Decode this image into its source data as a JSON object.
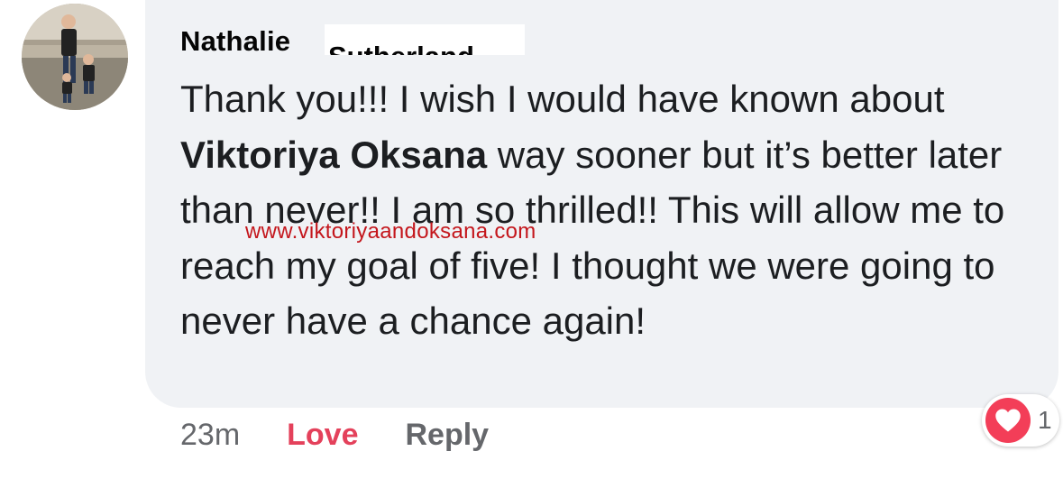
{
  "comment": {
    "author": "Nathalie",
    "author_redacted_fragment": "Sutherland",
    "text_before": "Thank you!!! I wish I would have known about ",
    "mention": "Viktoriya Oksana",
    "text_after": " way sooner but it’s better later than never!! I am so thrilled!! This will allow me to reach my goal of five! I thought we were going to never have a chance again!"
  },
  "watermark": "www.viktoriyaandoksana.com",
  "actions": {
    "time": "23m",
    "love_label": "Love",
    "reply_label": "Reply"
  },
  "reaction": {
    "icon": "heart-icon",
    "count": "1"
  },
  "colors": {
    "bubble": "#f0f2f5",
    "love": "#e4415b",
    "heart": "#f33e58",
    "watermark": "#c4161c",
    "secondary_text": "#65676b"
  }
}
